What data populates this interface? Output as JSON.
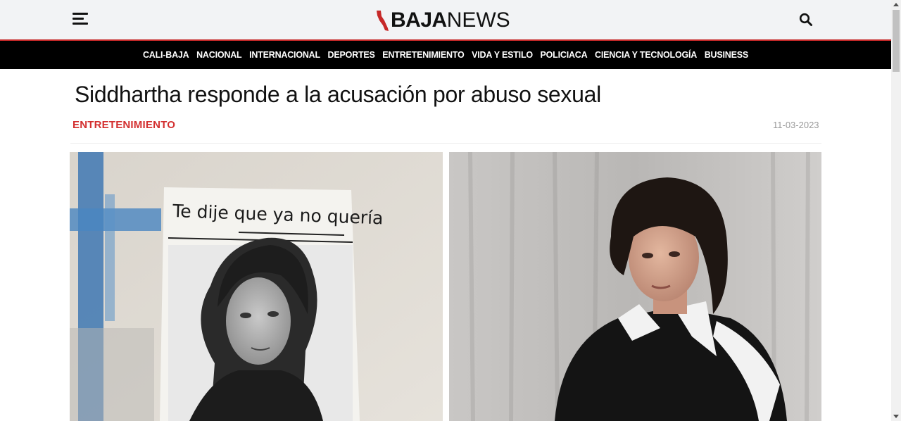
{
  "header": {
    "logo_bold": "BAJA",
    "logo_light": "NEWS",
    "menu_icon": "hamburger-icon",
    "search_icon": "search-icon",
    "accent_color": "#c62828"
  },
  "nav": {
    "items": [
      {
        "label": "CALI-BAJA"
      },
      {
        "label": "NACIONAL"
      },
      {
        "label": "INTERNACIONAL"
      },
      {
        "label": "DEPORTES"
      },
      {
        "label": "ENTRETENIMIENTO"
      },
      {
        "label": "VIDA Y ESTILO"
      },
      {
        "label": "POLICIACA"
      },
      {
        "label": "CIENCIA Y TECNOLOGÍA"
      },
      {
        "label": "BUSINESS"
      }
    ]
  },
  "article": {
    "title": "Siddhartha responde a la acusación por abuso sexual",
    "category": "ENTRETENIMIENTO",
    "category_color": "#d32f2f",
    "date": "11-03-2023",
    "images": {
      "left_caption_text": "Te dije que ya no quería"
    }
  }
}
